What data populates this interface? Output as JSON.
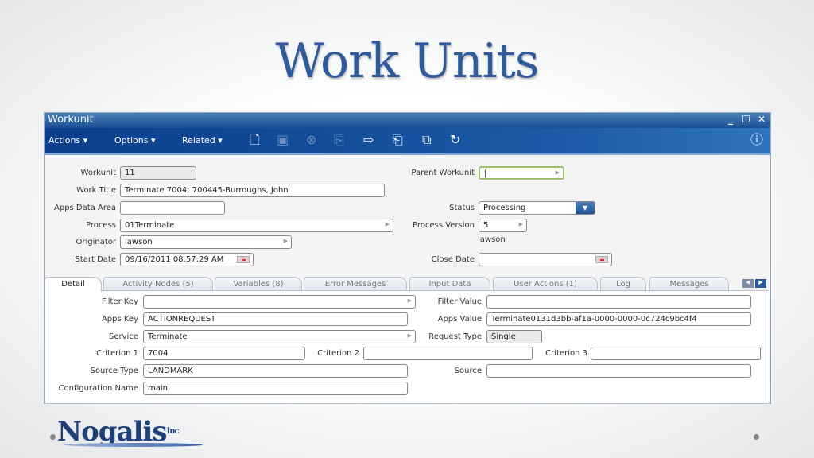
{
  "slide": {
    "title": "Work Units",
    "logo_text": "Nogalis",
    "logo_suffix": "Inc"
  },
  "window": {
    "title": "Workunit",
    "controls": [
      "minimize",
      "maximize",
      "close"
    ]
  },
  "toolbar": {
    "menus": [
      {
        "label": "Actions ▾"
      },
      {
        "label": "Options ▾"
      },
      {
        "label": "Related ▾"
      }
    ],
    "icons": [
      "new-icon",
      "save-icon",
      "delete-icon",
      "copy-icon",
      "export-icon",
      "open-icon",
      "duplicate-icon",
      "refresh-icon",
      "help-icon"
    ]
  },
  "header": {
    "workunit": {
      "label": "Workunit",
      "value": "11"
    },
    "work_title": {
      "label": "Work Title",
      "value": "Terminate 7004; 700445-Burroughs, John"
    },
    "apps_data_area": {
      "label": "Apps Data Area",
      "value": ""
    },
    "process": {
      "label": "Process",
      "value": "01Terminate"
    },
    "originator": {
      "label": "Originator",
      "value": "lawson"
    },
    "start_date": {
      "label": "Start Date",
      "value": "09/16/2011 08:57:29 AM"
    },
    "parent_workunit": {
      "label": "Parent Workunit",
      "value": "|"
    },
    "status": {
      "label": "Status",
      "value": "Processing"
    },
    "process_version": {
      "label": "Process Version",
      "value": "5"
    },
    "originator_name": "lawson",
    "close_date": {
      "label": "Close Date",
      "value": ""
    }
  },
  "tabs": [
    {
      "label": "Detail",
      "active": true
    },
    {
      "label": "Activity Nodes (5)"
    },
    {
      "label": "Variables (8)"
    },
    {
      "label": "Error Messages"
    },
    {
      "label": "Input Data"
    },
    {
      "label": "User Actions (1)"
    },
    {
      "label": "Log"
    },
    {
      "label": "Messages"
    }
  ],
  "detail": {
    "filter_key": {
      "label": "Filter Key",
      "value": ""
    },
    "filter_value": {
      "label": "Filter Value",
      "value": ""
    },
    "apps_key": {
      "label": "Apps Key",
      "value": "ACTIONREQUEST"
    },
    "apps_value": {
      "label": "Apps Value",
      "value": "Terminate0131d3bb-af1a-0000-0000-0c724c9bc4f4"
    },
    "service": {
      "label": "Service",
      "value": "Terminate"
    },
    "request_type": {
      "label": "Request Type",
      "value": "Single"
    },
    "criterion1": {
      "label": "Criterion 1",
      "value": "7004"
    },
    "criterion2": {
      "label": "Criterion 2",
      "value": ""
    },
    "criterion3": {
      "label": "Criterion 3",
      "value": ""
    },
    "source_type": {
      "label": "Source Type",
      "value": "LANDMARK"
    },
    "source": {
      "label": "Source",
      "value": ""
    },
    "configuration_name": {
      "label": "Configuration Name",
      "value": "main"
    }
  }
}
